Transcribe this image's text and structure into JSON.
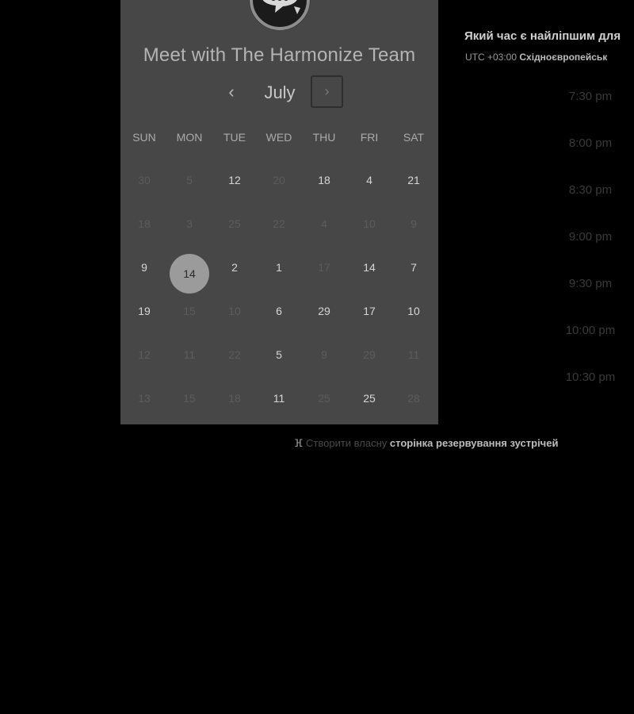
{
  "title": "Meet with The Harmonize Team",
  "calendar": {
    "prev_label": "‹",
    "month": "July",
    "next_label": "›",
    "weekdays": [
      "SUN",
      "MON",
      "TUE",
      "WED",
      "THU",
      "FRI",
      "SAT"
    ],
    "weeks": [
      [
        {
          "d": "30",
          "m": true
        },
        {
          "d": "5",
          "m": true
        },
        {
          "d": "12",
          "m": false
        },
        {
          "d": "20",
          "m": true
        },
        {
          "d": "18",
          "m": false
        },
        {
          "d": "4",
          "m": false
        },
        {
          "d": "21",
          "m": false
        }
      ],
      [
        {
          "d": "18",
          "m": true
        },
        {
          "d": "3",
          "m": true
        },
        {
          "d": "25",
          "m": true
        },
        {
          "d": "22",
          "m": true
        },
        {
          "d": "4",
          "m": true
        },
        {
          "d": "10",
          "m": true
        },
        {
          "d": "9",
          "m": true
        }
      ],
      [
        {
          "d": "9",
          "m": false
        },
        {
          "d": "14",
          "m": false,
          "selected": true
        },
        {
          "d": "2",
          "m": false
        },
        {
          "d": "1",
          "m": false
        },
        {
          "d": "17",
          "m": true
        },
        {
          "d": "14",
          "m": false
        },
        {
          "d": "7",
          "m": false
        }
      ],
      [
        {
          "d": "19",
          "m": false
        },
        {
          "d": "15",
          "m": true
        },
        {
          "d": "10",
          "m": true
        },
        {
          "d": "6",
          "m": false
        },
        {
          "d": "29",
          "m": false
        },
        {
          "d": "17",
          "m": false
        },
        {
          "d": "10",
          "m": false
        }
      ],
      [
        {
          "d": "12",
          "m": true
        },
        {
          "d": "11",
          "m": true
        },
        {
          "d": "22",
          "m": true
        },
        {
          "d": "5",
          "m": false
        },
        {
          "d": "9",
          "m": true
        },
        {
          "d": "29",
          "m": true
        },
        {
          "d": "11",
          "m": true
        }
      ],
      [
        {
          "d": "13",
          "m": true
        },
        {
          "d": "15",
          "m": true
        },
        {
          "d": "18",
          "m": true
        },
        {
          "d": "11",
          "m": false
        },
        {
          "d": "25",
          "m": true
        },
        {
          "d": "25",
          "m": false
        },
        {
          "d": "28",
          "m": true
        }
      ]
    ]
  },
  "schedule": {
    "question": "Який час є найліпшим для",
    "timezone_prefix": "UTC +03:00",
    "timezone_name": "Східноєвропейськ",
    "times": [
      "7:30 pm",
      "8:00 pm",
      "8:30 pm",
      "9:00 pm",
      "9:30 pm",
      "10:00 pm",
      "10:30 pm"
    ]
  },
  "footer": {
    "link_dim": "Створити власну",
    "link_bright": "сторінка резервування зустрічей"
  },
  "colors": {
    "background": "#000000",
    "panel": "#474747",
    "selected_day": "#9b9b9b"
  },
  "icons": {
    "avatar": "chat-bubble-logo",
    "footer": "sprocket-icon"
  }
}
